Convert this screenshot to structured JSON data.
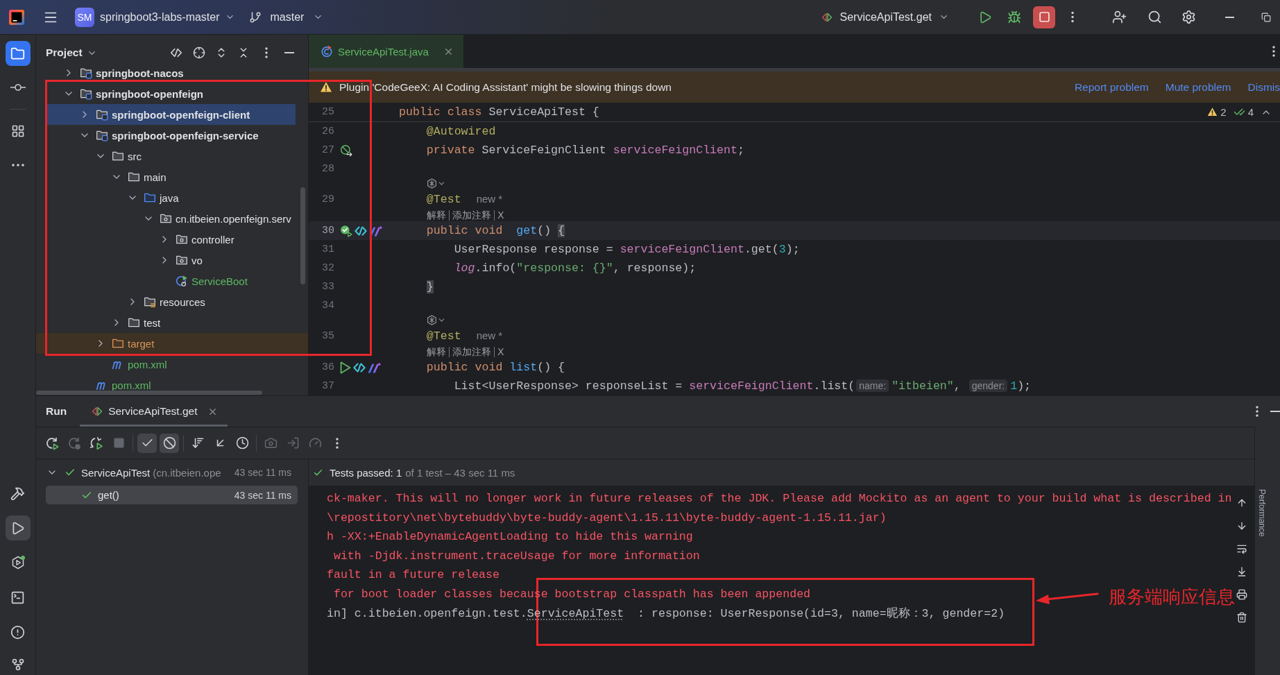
{
  "title_bar": {
    "project_badge": "SM",
    "project": "springboot3-labs-master",
    "branch": "master",
    "run_config": "ServiceApiTest.get"
  },
  "tool_strip": {
    "top": [
      {
        "selected": true
      },
      {
        "selected": false
      },
      {
        "selected": false
      },
      {
        "selected": false
      }
    ],
    "bottom": [
      {
        "selected": false
      },
      {
        "selected": true
      },
      {
        "selected": false
      },
      {
        "selected": false
      },
      {
        "selected": false
      },
      {
        "selected": false
      }
    ]
  },
  "project_panel": {
    "title": "Project",
    "tree": [
      {
        "label": "springboot-nacos",
        "kind": "module",
        "expanded": false,
        "selected": false
      },
      {
        "label": "springboot-openfeign",
        "kind": "module",
        "expanded": true,
        "selected": false,
        "children": [
          {
            "label": "springboot-openfeign-client",
            "kind": "module",
            "expanded": false,
            "selected": true
          },
          {
            "label": "springboot-openfeign-service",
            "kind": "module",
            "expanded": true,
            "selected": false,
            "children": [
              {
                "label": "src",
                "kind": "folder",
                "expanded": true,
                "selected": false,
                "children": [
                  {
                    "label": "main",
                    "kind": "folder",
                    "expanded": true,
                    "selected": false,
                    "children": [
                      {
                        "label": "java",
                        "kind": "source_root",
                        "expanded": true,
                        "selected": false,
                        "children": [
                          {
                            "label": "cn.itbeien.openfeign.serv",
                            "kind": "package",
                            "expanded": true,
                            "selected": false,
                            "children": [
                              {
                                "label": "controller",
                                "kind": "package",
                                "expanded": false,
                                "selected": false
                              },
                              {
                                "label": "vo",
                                "kind": "package",
                                "expanded": false,
                                "selected": false
                              },
                              {
                                "label": "ServiceBoot",
                                "kind": "boot_class",
                                "selected": false,
                                "color": "#5fb865"
                              }
                            ]
                          }
                        ]
                      },
                      {
                        "label": "resources",
                        "kind": "resource_root",
                        "expanded": false,
                        "selected": false
                      }
                    ]
                  },
                  {
                    "label": "test",
                    "kind": "folder",
                    "expanded": false,
                    "selected": false
                  }
                ]
              },
              {
                "label": "target",
                "kind": "excluded_folder",
                "expanded": false,
                "selected": false
              },
              {
                "label": "pom.xml",
                "kind": "maven",
                "selected": false,
                "color": "#5fb865"
              }
            ]
          },
          {
            "label": "pom.xml",
            "kind": "maven",
            "selected": false,
            "color": "#5fb865"
          }
        ]
      }
    ]
  },
  "editor": {
    "tab": {
      "label": "ServiceApiTest.java",
      "selected": true
    },
    "banner": {
      "message": "Plugin 'CodeGeeX: AI Coding Assistant' might be slowing things down",
      "actions": [
        "Report problem",
        "Mute problem",
        "Dismis"
      ]
    },
    "inspections": {
      "warnings": "2",
      "passed": "4"
    },
    "lines": [
      {
        "kind": "sticky",
        "number": "25",
        "tokens": [
          {
            "text": "public class ",
            "kind": "keyword"
          },
          {
            "text": "ServiceApiTest {",
            "kind": "plain"
          }
        ]
      },
      {
        "kind": "code",
        "number": "26",
        "current": false,
        "tokens": [
          {
            "text": "    @Autowired",
            "kind": "annotation"
          }
        ]
      },
      {
        "kind": "code",
        "number": "27",
        "current": false,
        "gutter": [
          {
            "kind": "bean"
          }
        ],
        "tokens": [
          {
            "text": "    private ",
            "kind": "keyword"
          },
          {
            "text": "ServiceFeignClient ",
            "kind": "plain"
          },
          {
            "text": "serviceFeignClient",
            "kind": "field"
          },
          {
            "text": ";",
            "kind": "plain"
          }
        ]
      },
      {
        "kind": "code",
        "number": "28",
        "current": false
      },
      {
        "kind": "ai_hint"
      },
      {
        "kind": "code",
        "number": "29",
        "current": false,
        "tokens": [
          {
            "text": "    @Test",
            "kind": "annotation"
          },
          {
            "text": "new *",
            "kind": "author"
          }
        ]
      },
      {
        "kind": "lens",
        "items": [
          "解释",
          "添加注释",
          "X"
        ]
      },
      {
        "kind": "code",
        "number": "30",
        "current": true,
        "gutter": [
          {
            "kind": "test_passed"
          },
          {
            "kind": "code_link"
          },
          {
            "kind": "ai"
          }
        ],
        "tokens": [
          {
            "text": "    public void ",
            "kind": "keyword"
          },
          {
            "text": " get",
            "kind": "method"
          },
          {
            "text": "() ",
            "kind": "plain"
          },
          {
            "text": "{",
            "kind": "brace_match"
          }
        ]
      },
      {
        "kind": "code",
        "number": "31",
        "current": false,
        "tokens": [
          {
            "text": "        UserResponse response = ",
            "kind": "plain"
          },
          {
            "text": "serviceFeignClient",
            "kind": "field"
          },
          {
            "text": ".get(",
            "kind": "plain"
          },
          {
            "text": "3",
            "kind": "number"
          },
          {
            "text": ");",
            "kind": "plain"
          }
        ]
      },
      {
        "kind": "code",
        "number": "32",
        "current": false,
        "tokens": [
          {
            "text": "        log",
            "kind": "static"
          },
          {
            "text": ".info(",
            "kind": "plain"
          },
          {
            "text": "\"response: {}\"",
            "kind": "string"
          },
          {
            "text": ", response);",
            "kind": "plain"
          }
        ]
      },
      {
        "kind": "code",
        "number": "33",
        "current": false,
        "tokens": [
          {
            "text": "    }",
            "kind": "brace_match"
          }
        ]
      },
      {
        "kind": "code",
        "number": "34",
        "current": false
      },
      {
        "kind": "ai_hint"
      },
      {
        "kind": "code",
        "number": "35",
        "current": false,
        "tokens": [
          {
            "text": "    @Test",
            "kind": "annotation"
          },
          {
            "text": "new *",
            "kind": "author"
          }
        ]
      },
      {
        "kind": "lens",
        "items": [
          "解释",
          "添加注释",
          "X"
        ]
      },
      {
        "kind": "code",
        "number": "36",
        "current": false,
        "gutter": [
          {
            "kind": "run"
          },
          {
            "kind": "code_link"
          },
          {
            "kind": "ai"
          }
        ],
        "tokens": [
          {
            "text": "    public void ",
            "kind": "keyword"
          },
          {
            "text": "list",
            "kind": "method"
          },
          {
            "text": "() {",
            "kind": "plain"
          }
        ]
      },
      {
        "kind": "code",
        "number": "37",
        "current": false,
        "tokens": [
          {
            "text": "        List<UserResponse> responseList = ",
            "kind": "plain"
          },
          {
            "text": "serviceFeignClient",
            "kind": "field"
          },
          {
            "text": ".list(",
            "kind": "plain"
          },
          {
            "text": "name:",
            "kind": "param_hint"
          },
          {
            "text": "\"itbeien\"",
            "kind": "string"
          },
          {
            "text": ", ",
            "kind": "plain"
          },
          {
            "text": "gender:",
            "kind": "param_hint"
          },
          {
            "text": "1",
            "kind": "number"
          },
          {
            "text": ");",
            "kind": "plain"
          }
        ]
      }
    ]
  },
  "run_panel": {
    "title": "Run",
    "tab": {
      "label": "ServiceApiTest.get",
      "selected": true
    },
    "toolbar": [
      [
        {
          "selected": false,
          "disabled": false
        },
        {
          "selected": false,
          "disabled": true
        },
        {
          "selected": false,
          "disabled": false
        },
        {
          "selected": false,
          "disabled": true
        }
      ],
      [
        {
          "selected": true,
          "disabled": false
        },
        {
          "selected": true,
          "disabled": false
        }
      ],
      [
        {
          "selected": false,
          "disabled": false
        },
        {
          "selected": false,
          "disabled": false
        },
        {
          "selected": false,
          "disabled": false
        }
      ],
      [
        {
          "selected": false,
          "disabled": true
        },
        {
          "selected": false,
          "disabled": true
        },
        {
          "selected": false,
          "disabled": true
        },
        {
          "selected": false,
          "disabled": false
        }
      ]
    ],
    "tests": [
      {
        "label": "ServiceApiTest",
        "detail": "(cn.itbeien.ope",
        "time": "43 sec 11 ms",
        "passed": true,
        "expanded": true,
        "selected": false,
        "children": [
          {
            "label": "get()",
            "time": "43 sec 11 ms",
            "passed": true,
            "selected": true
          }
        ]
      }
    ],
    "summary": {
      "passed": true,
      "title": "Tests passed: 1",
      "detail": "of 1 test – 43 sec 11 ms"
    },
    "console": [
      {
        "kind": "stderr",
        "segments": [
          {
            "text": "ck-maker. This will no longer work in future releases of the JDK. Please add Mockito as an agent to your build what is described in"
          }
        ]
      },
      {
        "kind": "stderr",
        "segments": [
          {
            "text": "\\repostitory\\net\\bytebuddy\\byte-buddy-agent\\1.15.11\\byte-buddy-agent-1.15.11.jar)"
          }
        ]
      },
      {
        "kind": "stderr",
        "segments": [
          {
            "text": "h -XX:+EnableDynamicAgentLoading to hide this warning"
          }
        ]
      },
      {
        "kind": "stderr",
        "segments": [
          {
            "text": " with -Djdk.instrument.traceUsage for more information"
          }
        ]
      },
      {
        "kind": "stderr",
        "segments": [
          {
            "text": "fault in a future release"
          }
        ]
      },
      {
        "kind": "stderr",
        "segments": [
          {
            "text": " for boot loader classes because bootstrap classpath has been appended"
          }
        ]
      },
      {
        "kind": "stdout",
        "segments": [
          {
            "text": "in] c.itbeien.openfeign.test."
          },
          {
            "text": "ServiceApiTest",
            "link": true
          },
          {
            "text": "  : response: UserResponse(id=3, name=昵称：3, gender=2)"
          }
        ]
      }
    ],
    "side_strip": {
      "label": "Performance"
    }
  },
  "annotation": {
    "callout": "服务端响应信息"
  }
}
